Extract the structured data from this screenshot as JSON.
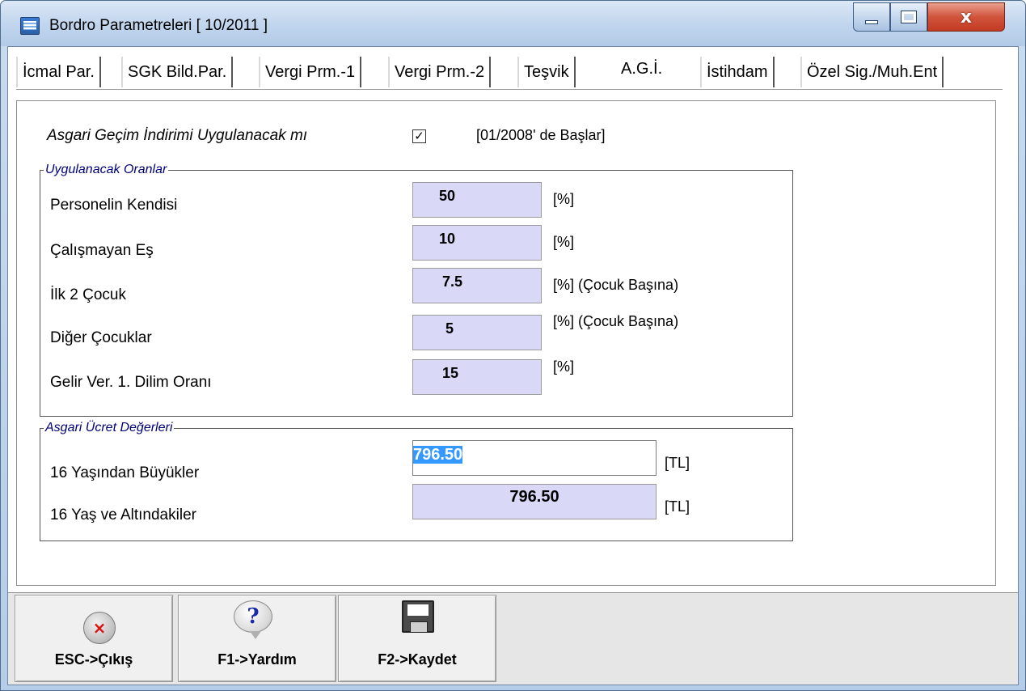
{
  "window": {
    "title": "Bordro Parametreleri [ 10/2011 ]",
    "close_symbol": "x"
  },
  "tabs": [
    {
      "label": "İcmal Par."
    },
    {
      "label": "SGK Bild.Par."
    },
    {
      "label": "Vergi Prm.-1"
    },
    {
      "label": "Vergi Prm.-2"
    },
    {
      "label": "Teşvik"
    },
    {
      "label": "A.G.İ.",
      "active": true
    },
    {
      "label": "İstihdam"
    },
    {
      "label": "Özel Sig./Muh.Ent"
    }
  ],
  "agi": {
    "question": "Asgari Geçim İndirimi Uygulanacak mı",
    "checked": true,
    "check_mark": "✓",
    "note": "[01/2008' de Başlar]"
  },
  "rates": {
    "title": "Uygulanacak Oranlar",
    "rows": [
      {
        "label": "Personelin Kendisi",
        "value": "50",
        "unit": "[%]"
      },
      {
        "label": "Çalışmayan Eş",
        "value": "10",
        "unit": "[%]"
      },
      {
        "label": "İlk 2 Çocuk",
        "value": "7.5",
        "unit": "[%] (Çocuk Başına)"
      },
      {
        "label": "Diğer Çocuklar",
        "value": "5",
        "unit": "[%] (Çocuk Başına)"
      },
      {
        "label": "Gelir Ver. 1. Dilim Oranı",
        "value": "15",
        "unit": "[%]"
      }
    ]
  },
  "wages": {
    "title": "Asgari Ücret Değerleri",
    "over16": {
      "label": "16 Yaşından Büyükler",
      "value": "796.50",
      "unit": "[TL]"
    },
    "under16": {
      "label": "16 Yaş ve Altındakiler",
      "value": "796.50",
      "unit": "[TL]"
    }
  },
  "toolbar": {
    "exit_label": "ESC->Çıkış",
    "exit_symbol": "×",
    "help_label": "F1->Yardım",
    "help_symbol": "?",
    "save_label": "F2->Kaydet"
  },
  "colors": {
    "readonly_field_bg": "#d9d9f7",
    "group_title": "#00007a",
    "selection": "#3399ff",
    "close_button": "#c33a22"
  },
  "icons": [
    "app-icon",
    "close-icon",
    "help-icon",
    "save-disk-icon"
  ]
}
